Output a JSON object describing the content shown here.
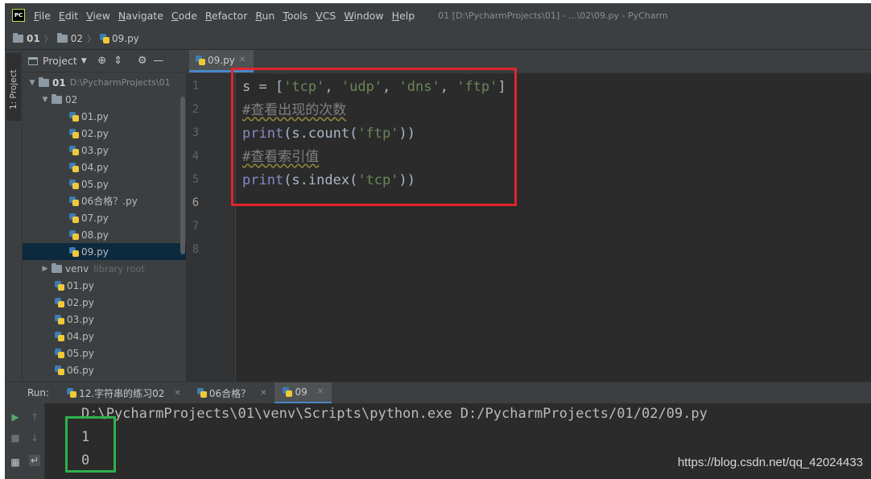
{
  "window": {
    "logo_text": "PC",
    "title": "01 [D:\\PycharmProjects\\01] - ...\\02\\09.py - PyCharm"
  },
  "menu": [
    "File",
    "Edit",
    "View",
    "Navigate",
    "Code",
    "Refactor",
    "Run",
    "Tools",
    "VCS",
    "Window",
    "Help"
  ],
  "breadcrumb": [
    "01",
    "02",
    "09.py"
  ],
  "tool_strip": {
    "label": "1: Project"
  },
  "project_panel": {
    "title": "Project",
    "root": {
      "name": "01",
      "path": "D:\\PycharmProjects\\01"
    },
    "folder_02": {
      "name": "02",
      "files": [
        "01.py",
        "02.py",
        "03.py",
        "04.py",
        "05.py",
        "06合格？.py",
        "07.py",
        "08.py",
        "09.py"
      ]
    },
    "venv": {
      "name": "venv",
      "note": "library root"
    },
    "root_files": [
      "01.py",
      "02.py",
      "03.py",
      "04.py",
      "05.py",
      "06.py"
    ]
  },
  "editor": {
    "tab_label": "09.py",
    "line_numbers": [
      "1",
      "2",
      "3",
      "4",
      "5",
      "6",
      "7",
      "8"
    ],
    "code": {
      "l1": {
        "a": "s = [",
        "b": "'tcp'",
        "c": ", ",
        "d": "'udp'",
        "e": ", ",
        "f": "'dns'",
        "g": ", ",
        "h": "'ftp'",
        "i": "]"
      },
      "l2": "#查看出现的次数",
      "l3": {
        "fn": "print",
        "a": "(s.count(",
        "s": "'ftp'",
        "b": "))"
      },
      "l4": "#查看索引值",
      "l5": {
        "fn": "print",
        "a": "(s.index(",
        "s": "'tcp'",
        "b": "))"
      }
    }
  },
  "run": {
    "label": "Run:",
    "tabs": [
      "12.字符串的练习02",
      "06合格？",
      "09"
    ],
    "console": [
      "D:\\PycharmProjects\\01\\venv\\Scripts\\python.exe D:/PycharmProjects/01/02/09.py",
      "1",
      "0"
    ]
  },
  "watermark": "https://blog.csdn.net/qq_42024433",
  "colors": {
    "highlight_red": "#e0242b",
    "highlight_green": "#2db14c",
    "editor_bg": "#2b2b2b",
    "panel_bg": "#3c3f41"
  }
}
